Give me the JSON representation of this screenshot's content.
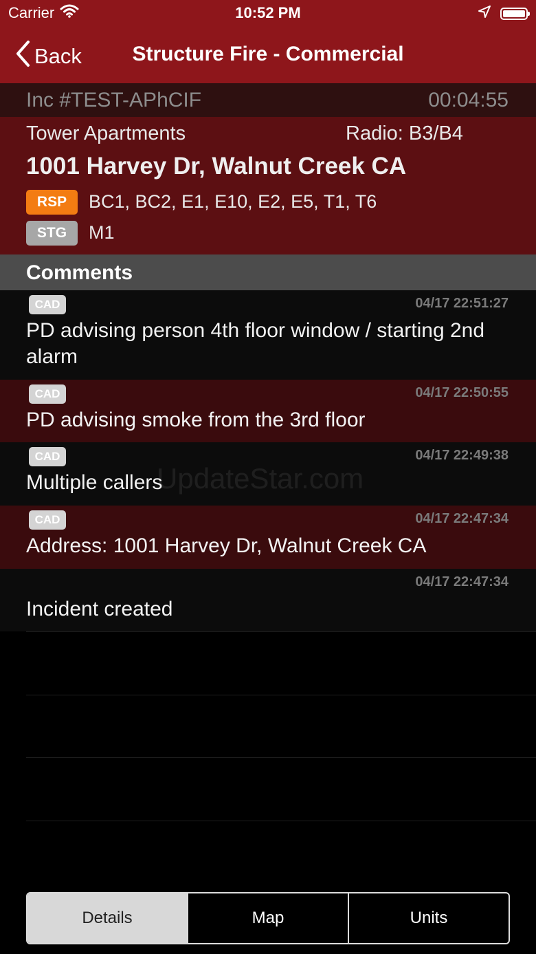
{
  "status_bar": {
    "carrier": "Carrier",
    "time": "10:52 PM"
  },
  "nav": {
    "back_label": "Back",
    "title": "Structure Fire - Commercial"
  },
  "incident": {
    "number": "Inc #TEST-APhCIF",
    "elapsed": "00:04:55",
    "place": "Tower Apartments",
    "radio": "Radio: B3/B4",
    "address": "1001 Harvey Dr, Walnut Creek CA",
    "responding_badge": "RSP",
    "responding_units": "BC1, BC2, E1, E10, E2, E5, T1, T6",
    "staging_badge": "STG",
    "staging_units": "M1"
  },
  "comments": {
    "header": "Comments",
    "items": [
      {
        "source": "CAD",
        "timestamp": "04/17 22:51:27",
        "text": "PD advising person 4th floor window / starting 2nd alarm"
      },
      {
        "source": "CAD",
        "timestamp": "04/17 22:50:55",
        "text": "PD advising smoke from the 3rd floor"
      },
      {
        "source": "CAD",
        "timestamp": "04/17 22:49:38",
        "text": "Multiple callers"
      },
      {
        "source": "CAD",
        "timestamp": "04/17 22:47:34",
        "text": "Address: 1001 Harvey Dr, Walnut Creek CA"
      },
      {
        "source": "",
        "timestamp": "04/17 22:47:34",
        "text": "Incident created"
      }
    ]
  },
  "watermark": "UpdateStar.com",
  "tabs": {
    "details": "Details",
    "map": "Map",
    "units": "Units",
    "selected": "Details"
  },
  "colors": {
    "nav_red": "#8e161b",
    "info_red": "#5c0f12",
    "rsp_orange": "#f37c12",
    "stg_gray": "#a7a7a7"
  }
}
